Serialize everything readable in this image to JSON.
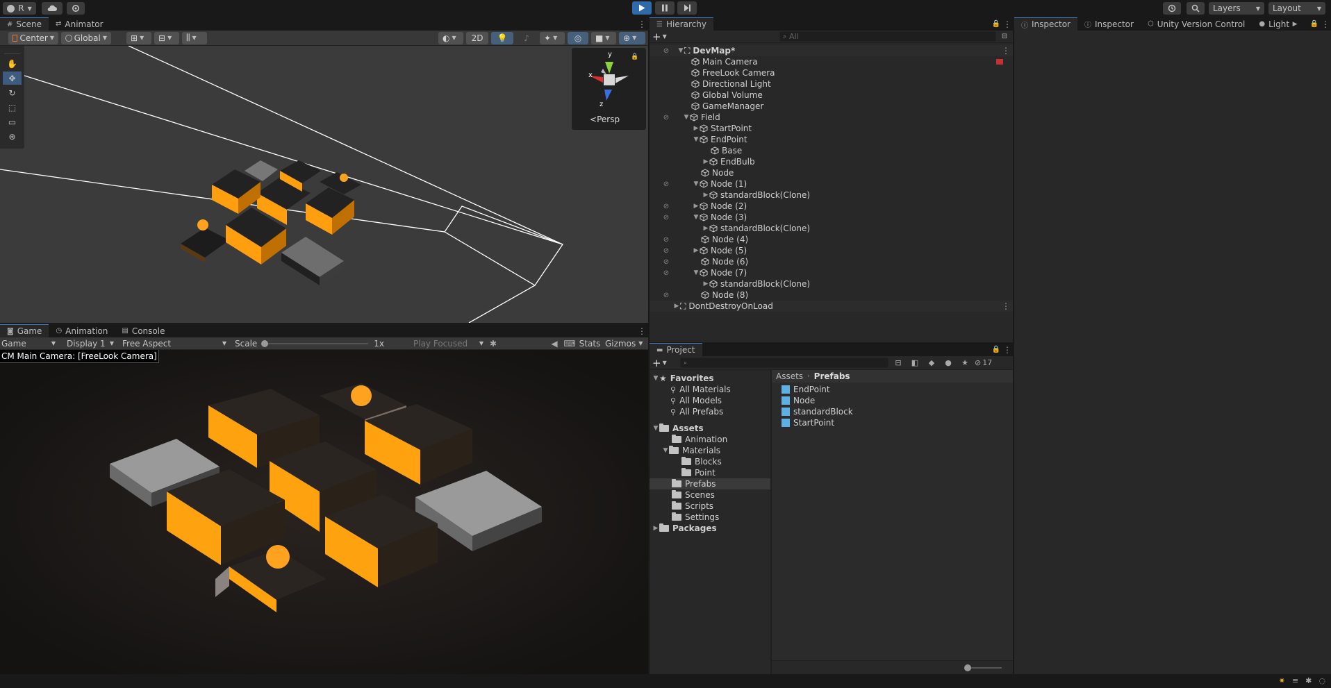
{
  "toolbar": {
    "account_label": "R",
    "layers_label": "Layers",
    "layout_label": "Layout"
  },
  "scene": {
    "tabs": [
      {
        "label": "Scene"
      },
      {
        "label": "Animator"
      }
    ],
    "pivot_label": "Center",
    "space_label": "Global",
    "mode_2d": "2D",
    "gizmo_view": "Persp",
    "gizmo_axes": {
      "x": "x",
      "y": "y",
      "z": "z"
    }
  },
  "game": {
    "tabs": [
      {
        "label": "Game"
      },
      {
        "label": "Animation"
      },
      {
        "label": "Console"
      }
    ],
    "display_mode": "Game",
    "display": "Display 1",
    "aspect": "Free Aspect",
    "scale_label": "Scale",
    "scale_value": "1x",
    "play_focused": "Play Focused",
    "stats": "Stats",
    "gizmos": "Gizmos",
    "camera_label": "CM Main Camera: [FreeLook Camera]"
  },
  "hierarchy": {
    "tab": "Hierarchy",
    "search_placeholder": "All",
    "items": [
      {
        "label": "DevMap*",
        "scene": true
      },
      {
        "label": "Main Camera"
      },
      {
        "label": "FreeLook Camera"
      },
      {
        "label": "Directional Light"
      },
      {
        "label": "Global Volume"
      },
      {
        "label": "GameManager"
      },
      {
        "label": "Field"
      },
      {
        "label": "StartPoint"
      },
      {
        "label": "EndPoint"
      },
      {
        "label": "Base"
      },
      {
        "label": "EndBulb"
      },
      {
        "label": "Node"
      },
      {
        "label": "Node (1)"
      },
      {
        "label": "standardBlock(Clone)"
      },
      {
        "label": "Node (2)"
      },
      {
        "label": "Node (3)"
      },
      {
        "label": "standardBlock(Clone)"
      },
      {
        "label": "Node (4)"
      },
      {
        "label": "Node (5)"
      },
      {
        "label": "Node (6)"
      },
      {
        "label": "Node (7)"
      },
      {
        "label": "standardBlock(Clone)"
      },
      {
        "label": "Node (8)"
      },
      {
        "label": "DontDestroyOnLoad",
        "scene": true
      }
    ]
  },
  "inspector": {
    "tabs": [
      {
        "label": "Inspector"
      },
      {
        "label": "Inspector"
      },
      {
        "label": "Unity Version Control"
      },
      {
        "label": "Light"
      }
    ]
  },
  "project": {
    "tab": "Project",
    "hidden_count": "17",
    "breadcrumb": {
      "root": "Assets",
      "current": "Prefabs"
    },
    "favorites": {
      "label": "Favorites",
      "items": [
        "All Materials",
        "All Models",
        "All Prefabs"
      ]
    },
    "tree": [
      {
        "label": "Assets"
      },
      {
        "label": "Animation"
      },
      {
        "label": "Materials"
      },
      {
        "label": "Blocks"
      },
      {
        "label": "Point"
      },
      {
        "label": "Prefabs"
      },
      {
        "label": "Scenes"
      },
      {
        "label": "Scripts"
      },
      {
        "label": "Settings"
      },
      {
        "label": "Packages"
      }
    ],
    "assets": [
      "EndPoint",
      "Node",
      "standardBlock",
      "StartPoint"
    ]
  },
  "colors": {
    "accent": "#3a79bb",
    "play_active": "#2f6aab",
    "orange": "#ff9f0f"
  }
}
